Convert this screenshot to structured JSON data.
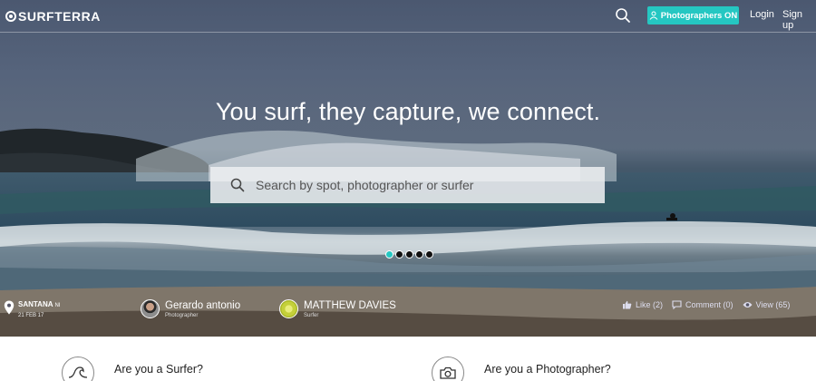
{
  "nav": {
    "logo_text": "SURFTERRA",
    "photographers_button": "Photographers ON",
    "login": "Login",
    "signup": "Sign up"
  },
  "hero": {
    "headline": "You surf, they capture, we connect.",
    "search_placeholder": "Search by spot, photographer or surfer",
    "slides_count": 5,
    "active_slide": 1
  },
  "photo_info": {
    "location_name": "SANTANA",
    "location_suffix": "NI",
    "date": "21 FEB 17",
    "photographer": {
      "name": "Gerardo antonio",
      "role": "Photographer"
    },
    "surfer": {
      "name": "MATTHEW DAVIES",
      "role": "Surfer"
    },
    "likes": "Like (2)",
    "comments": "Comment (0)",
    "views": "View (65)"
  },
  "roles": {
    "surfer": "Are you a Surfer?",
    "photographer": "Are you a Photographer?"
  },
  "colors": {
    "accent": "#25c7c2"
  }
}
